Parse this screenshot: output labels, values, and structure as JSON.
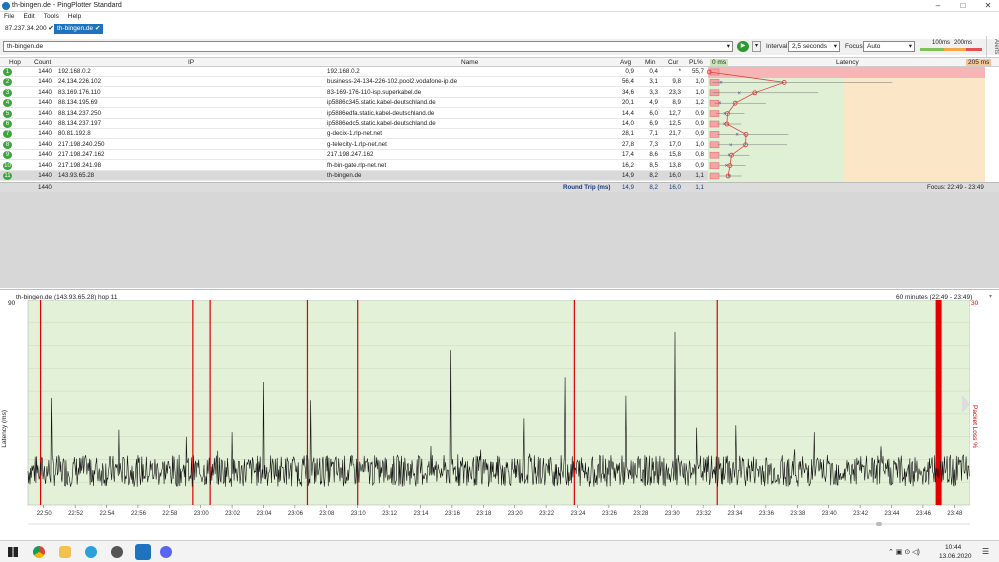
{
  "window": {
    "title": "th-bingen.de - PingPlotter Standard"
  },
  "menu": [
    "File",
    "Edit",
    "Tools",
    "Help"
  ],
  "tabs": [
    {
      "label": "87.237.34.200 ✔"
    },
    {
      "label": "th-bingen.de ✔"
    }
  ],
  "toolbar": {
    "target": "th-bingen.de",
    "interval_label": "Interval",
    "interval": "2,5 seconds",
    "focus_label": "Focus",
    "focus": "Auto",
    "scale_100": "100ms",
    "scale_200": "200ms",
    "alerts": "Alerts"
  },
  "table": {
    "headers": {
      "hop": "Hop",
      "count": "Count",
      "ip": "IP",
      "name": "Name",
      "avg": "Avg",
      "min": "Min",
      "cur": "Cur",
      "pl": "PL%",
      "lat_start": "0 ms",
      "latency": "Latency",
      "lat_end": "205 ms"
    },
    "rows": [
      {
        "hop": "1",
        "count": "1440",
        "ip": "192.168.0.2",
        "name": "192.168.0.2",
        "avg": "0,9",
        "min": "0,4",
        "cur": "*",
        "pl": "55,7"
      },
      {
        "hop": "2",
        "count": "1440",
        "ip": "24.134.226.102",
        "name": "business-24-134-226-102.pool2.vodafone-ip.de",
        "avg": "56,4",
        "min": "3,1",
        "cur": "9,8",
        "pl": "1,0"
      },
      {
        "hop": "3",
        "count": "1440",
        "ip": "83.169.176.110",
        "name": "83-169-176-110-isp.superkabel.de",
        "avg": "34,6",
        "min": "3,3",
        "cur": "23,3",
        "pl": "1,0"
      },
      {
        "hop": "4",
        "count": "1440",
        "ip": "88.134.195.69",
        "name": "ip5886c345.static.kabel-deutschland.de",
        "avg": "20,1",
        "min": "4,9",
        "cur": "8,9",
        "pl": "1,2"
      },
      {
        "hop": "5",
        "count": "1440",
        "ip": "88.134.237.250",
        "name": "ip5886edfa.static.kabel-deutschland.de",
        "avg": "14,4",
        "min": "6,0",
        "cur": "12,7",
        "pl": "0,9"
      },
      {
        "hop": "6",
        "count": "1440",
        "ip": "88.134.237.197",
        "name": "ip5886edc5.static.kabel-deutschland.de",
        "avg": "14,0",
        "min": "6,9",
        "cur": "12,5",
        "pl": "0,9"
      },
      {
        "hop": "7",
        "count": "1440",
        "ip": "80.81.192.8",
        "name": "g-decix-1.rlp-net.net",
        "avg": "28,1",
        "min": "7,1",
        "cur": "21,7",
        "pl": "0,9"
      },
      {
        "hop": "8",
        "count": "1440",
        "ip": "217.198.240.250",
        "name": "g-telecity-1.rlp-net.net",
        "avg": "27,8",
        "min": "7,3",
        "cur": "17,0",
        "pl": "1,0"
      },
      {
        "hop": "9",
        "count": "1440",
        "ip": "217.198.247.162",
        "name": "217.198.247.162",
        "avg": "17,4",
        "min": "8,6",
        "cur": "15,8",
        "pl": "0,8"
      },
      {
        "hop": "10",
        "count": "1440",
        "ip": "217.198.241.98",
        "name": "fh-bin-gate.rlp-net.net",
        "avg": "16,2",
        "min": "8,5",
        "cur": "13,8",
        "pl": "0,9"
      },
      {
        "hop": "11",
        "count": "1440",
        "ip": "143.93.65.28",
        "name": "th-bingen.de",
        "avg": "14,9",
        "min": "8,2",
        "cur": "16,0",
        "pl": "1,1"
      }
    ],
    "summary": {
      "count": "1440",
      "label": "Round Trip (ms)",
      "avg": "14,9",
      "min": "8,2",
      "cur": "16,0",
      "pl": "1,1",
      "focus": "Focus: 22:49 - 23:49"
    }
  },
  "colors": {
    "green": "#dff0d5",
    "orange": "#fbe6c8",
    "red": "#f7b5b5",
    "accent": "#1e73be",
    "loss": "#e00000",
    "series": "#111111"
  },
  "chart_data": {
    "type": "line",
    "title": "th-bingen.de (143.93.65.28) hop 11",
    "range_label": "60 minutes (22:49 - 23:49)",
    "ylabel": "Latency (ms)",
    "y2label": "Packet Loss %",
    "y_top": "90",
    "y2_top": "30",
    "ylim": [
      0,
      90
    ],
    "x_ticks": [
      "22:50",
      "22:52",
      "22:54",
      "22:56",
      "22:58",
      "23:00",
      "23:02",
      "23:04",
      "23:06",
      "23:08",
      "23:10",
      "23:12",
      "23:14",
      "23:16",
      "23:18",
      "23:20",
      "23:22",
      "23:24",
      "23:26",
      "23:28",
      "23:30",
      "23:32",
      "23:34",
      "23:36",
      "23:38",
      "23:40",
      "23:42",
      "23:44",
      "23:46",
      "23:48"
    ],
    "loss_minutes": [
      0.8,
      10.5,
      11.6,
      17.8,
      21.0,
      34.8,
      43.9,
      58.0
    ],
    "spikes": [
      {
        "t": 1.5,
        "v": 47
      },
      {
        "t": 5.8,
        "v": 33
      },
      {
        "t": 10.1,
        "v": 30
      },
      {
        "t": 13.0,
        "v": 32
      },
      {
        "t": 15.0,
        "v": 54
      },
      {
        "t": 18.0,
        "v": 46
      },
      {
        "t": 26.9,
        "v": 68
      },
      {
        "t": 31.6,
        "v": 38
      },
      {
        "t": 34.2,
        "v": 56
      },
      {
        "t": 38.1,
        "v": 48
      },
      {
        "t": 41.2,
        "v": 76
      },
      {
        "t": 42.6,
        "v": 34
      },
      {
        "t": 45.1,
        "v": 35
      },
      {
        "t": 50.1,
        "v": 32
      }
    ],
    "baseline_ms": [
      8,
      22
    ]
  },
  "taskbar": {
    "time": "10:44",
    "date": "13.06.2020"
  }
}
